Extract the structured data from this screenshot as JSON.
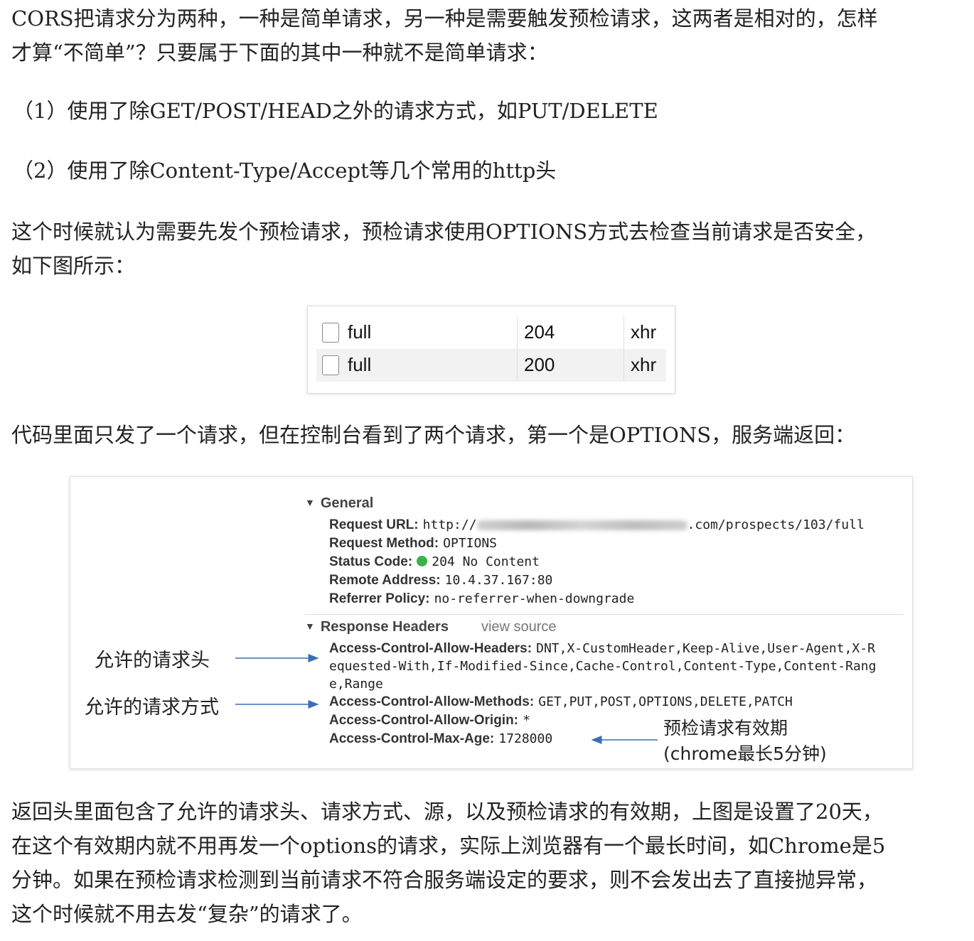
{
  "paragraphs": {
    "p1_line1": "CORS把请求分为两种，一种是简单请求，另一种是需要触发预检请求，这两者是相对的，怎样",
    "p1_line2": "才算“不简单”？只要属于下面的其中一种就不是简单请求：",
    "item1": "（1）使用了除GET/POST/HEAD之外的请求方式，如PUT/DELETE",
    "item2": "（2）使用了除Content-Type/Accept等几个常用的http头",
    "p2_line1": "这个时候就认为需要先发个预检请求，预检请求使用OPTIONS方式去检查当前请求是否安全，",
    "p2_line2": "如下图所示：",
    "p3": "代码里面只发了一个请求，但在控制台看到了两个请求，第一个是OPTIONS，服务端返回：",
    "p4_line1": "返回头里面包含了允许的请求头、请求方式、源，以及预检请求的有效期，上图是设置了20天，",
    "p4_line2": "在这个有效期内就不用再发一个options的请求，实际上浏览器有一个最长时间，如Chrome是5",
    "p4_line3": "分钟。如果在预检请求检测到当前请求不符合服务端设定的要求，则不会发出去了直接抛异常，",
    "p4_line4": "这个时候就不用去发“复杂”的请求了。"
  },
  "network_table": {
    "rows": [
      {
        "name": "full",
        "status": "204",
        "type": "xhr"
      },
      {
        "name": "full",
        "status": "200",
        "type": "xhr"
      }
    ]
  },
  "headers_panel": {
    "general_title": "General",
    "request_url_key": "Request URL:",
    "request_url_prefix": "http://",
    "request_url_suffix": ".com/prospects/103/full",
    "request_method_key": "Request Method:",
    "request_method_val": "OPTIONS",
    "status_code_key": "Status Code:",
    "status_code_val": "204 No Content",
    "status_color": "#37b34a",
    "remote_address_key": "Remote Address:",
    "remote_address_val": "10.4.37.167:80",
    "referrer_policy_key": "Referrer Policy:",
    "referrer_policy_val": "no-referrer-when-downgrade",
    "response_title": "Response Headers",
    "view_source": "view source",
    "acah_key": "Access-Control-Allow-Headers:",
    "acah_val1": "DNT,X-CustomHeader,Keep-Alive,User-Agent,X-R",
    "acah_val2": "equested-With,If-Modified-Since,Cache-Control,Content-Type,Content-Rang",
    "acah_val3": "e,Range",
    "acam_key": "Access-Control-Allow-Methods:",
    "acam_val": "GET,PUT,POST,OPTIONS,DELETE,PATCH",
    "acao_key": "Access-Control-Allow-Origin:",
    "acao_val": "*",
    "acma_key": "Access-Control-Max-Age:",
    "acma_val": "1728000",
    "anno_headers": "允许的请求头",
    "anno_methods": "允许的请求方式",
    "anno_maxage_1": "预检请求有效期",
    "anno_maxage_2": "(chrome最长5分钟)",
    "arrow_color": "#3a6fb5"
  }
}
